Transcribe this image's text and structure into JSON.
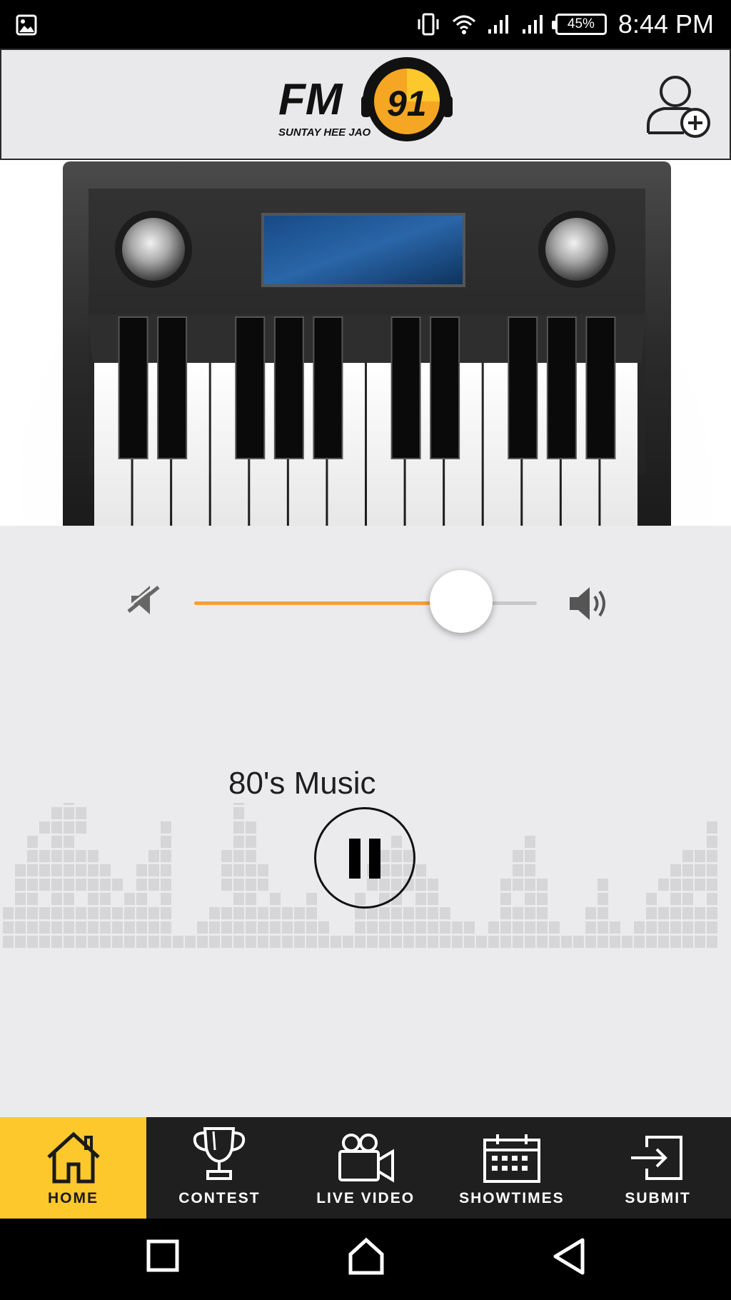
{
  "status_bar": {
    "time": "8:44 PM",
    "battery": "45%",
    "icons": [
      "image-icon",
      "vibrate-icon",
      "wifi-icon",
      "signal-icon",
      "signal-icon",
      "battery-icon"
    ]
  },
  "header": {
    "logo_text": "FM",
    "logo_number": "91",
    "logo_tagline": "SUNTAY HEE JAO",
    "action_icon": "add-user-icon"
  },
  "player": {
    "volume_percent": 78,
    "song_title": "80's Music",
    "state": "playing",
    "accent_color": "#f2a23a"
  },
  "tabs": [
    {
      "label": "HOME",
      "icon": "home-icon",
      "active": true
    },
    {
      "label": "CONTEST",
      "icon": "trophy-icon",
      "active": false
    },
    {
      "label": "LIVE VIDEO",
      "icon": "video-camera-icon",
      "active": false
    },
    {
      "label": "SHOWTIMES",
      "icon": "calendar-icon",
      "active": false
    },
    {
      "label": "SUBMIT",
      "icon": "submit-icon",
      "active": false
    }
  ],
  "theme": {
    "tab_active_bg": "#fcc82c",
    "tab_bg": "#1f1f1f"
  },
  "nav": {
    "buttons": [
      "recents-icon",
      "home-icon",
      "back-icon"
    ]
  }
}
